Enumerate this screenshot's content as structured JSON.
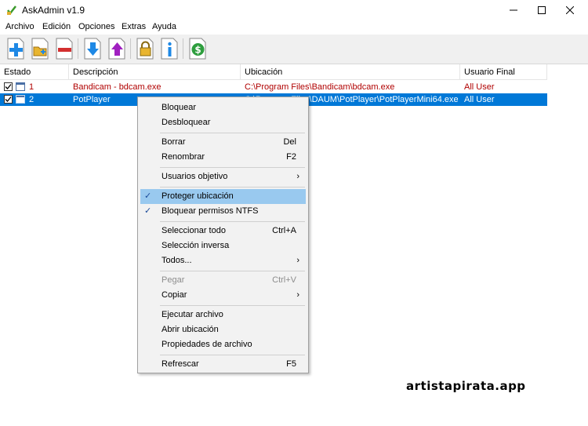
{
  "window": {
    "title": "AskAdmin v1.9"
  },
  "menubar": {
    "items": [
      "Archivo",
      "Edición",
      "Opciones",
      "Extras",
      "Ayuda"
    ]
  },
  "toolbar": {
    "buttons": [
      "add-icon",
      "add-folder-icon",
      "remove-icon",
      "down-arrow-icon",
      "up-arrow-icon",
      "lock-icon",
      "info-icon",
      "dollar-icon"
    ]
  },
  "table": {
    "columns": [
      "Estado",
      "Descripción",
      "Ubicación",
      "Usuario Final"
    ],
    "rows": [
      {
        "num": "1",
        "desc": "Bandicam - bdcam.exe",
        "loc": "C:\\Program Files\\Bandicam\\bdcam.exe",
        "user": "All User"
      },
      {
        "num": "2",
        "desc": "PotPlayer",
        "loc": "C:\\Program Files\\DAUM\\PotPlayer\\PotPlayerMini64.exe",
        "user": "All User"
      }
    ]
  },
  "context_menu": {
    "items": [
      {
        "label": "Bloquear",
        "shortcut": ""
      },
      {
        "label": "Desbloquear",
        "shortcut": ""
      },
      {
        "label": "Borrar",
        "shortcut": "Del"
      },
      {
        "label": "Renombrar",
        "shortcut": "F2"
      },
      {
        "label": "Usuarios objetivo",
        "shortcut": ""
      },
      {
        "label": "Proteger ubicación",
        "shortcut": ""
      },
      {
        "label": "Bloquear permisos NTFS",
        "shortcut": ""
      },
      {
        "label": "Seleccionar todo",
        "shortcut": "Ctrl+A"
      },
      {
        "label": "Selección inversa",
        "shortcut": ""
      },
      {
        "label": "Todos...",
        "shortcut": ""
      },
      {
        "label": "Pegar",
        "shortcut": "Ctrl+V"
      },
      {
        "label": "Copiar",
        "shortcut": ""
      },
      {
        "label": "Ejecutar archivo",
        "shortcut": ""
      },
      {
        "label": "Abrir ubicación",
        "shortcut": ""
      },
      {
        "label": "Propiedades de archivo",
        "shortcut": ""
      },
      {
        "label": "Refrescar",
        "shortcut": "F5"
      }
    ],
    "arrow_glyph": "›",
    "check_glyph": "✓"
  },
  "watermark": "artistapirata.app",
  "colors": {
    "selection": "#0078d7",
    "row_text_red": "#b00000",
    "menu_checked": "#99c9ef"
  }
}
